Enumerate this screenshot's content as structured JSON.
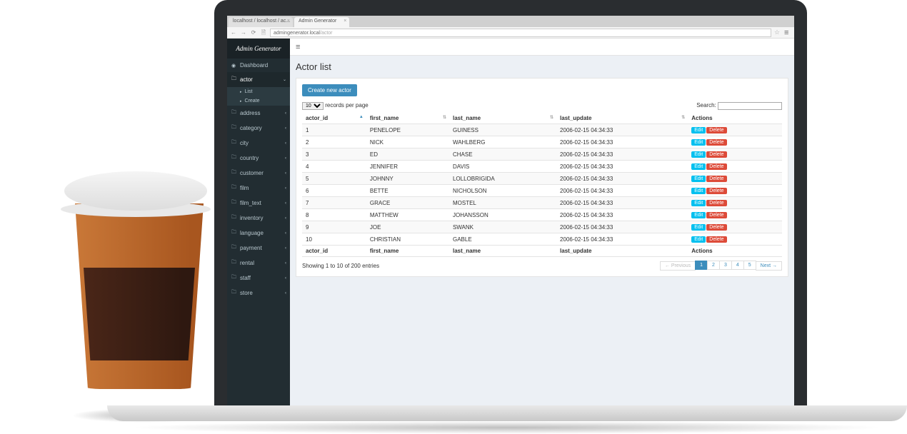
{
  "browser": {
    "tabs": [
      {
        "label": "localhost / localhost / ac..."
      },
      {
        "label": "Admin Generator"
      }
    ],
    "url_host": "admingenerator.local",
    "url_path": "/actor"
  },
  "brand": "Admin Generator",
  "sidebar": {
    "dashboard": "Dashboard",
    "items": [
      {
        "label": "actor",
        "expanded": true,
        "sub": [
          "List",
          "Create"
        ]
      },
      {
        "label": "address"
      },
      {
        "label": "category"
      },
      {
        "label": "city"
      },
      {
        "label": "country"
      },
      {
        "label": "customer"
      },
      {
        "label": "film"
      },
      {
        "label": "film_text"
      },
      {
        "label": "inventory"
      },
      {
        "label": "language"
      },
      {
        "label": "payment"
      },
      {
        "label": "rental"
      },
      {
        "label": "staff"
      },
      {
        "label": "store"
      }
    ]
  },
  "page": {
    "title": "Actor list",
    "create_btn": "Create new actor",
    "records_per_page_prefix": "10",
    "records_per_page_suffix": "records per page",
    "search_label": "Search:",
    "columns": [
      "actor_id",
      "first_name",
      "last_name",
      "last_update",
      "Actions"
    ],
    "rows": [
      {
        "id": "1",
        "first": "PENELOPE",
        "last": "GUINESS",
        "updated": "2006-02-15 04:34:33"
      },
      {
        "id": "2",
        "first": "NICK",
        "last": "WAHLBERG",
        "updated": "2006-02-15 04:34:33"
      },
      {
        "id": "3",
        "first": "ED",
        "last": "CHASE",
        "updated": "2006-02-15 04:34:33"
      },
      {
        "id": "4",
        "first": "JENNIFER",
        "last": "DAVIS",
        "updated": "2006-02-15 04:34:33"
      },
      {
        "id": "5",
        "first": "JOHNNY",
        "last": "LOLLOBRIGIDA",
        "updated": "2006-02-15 04:34:33"
      },
      {
        "id": "6",
        "first": "BETTE",
        "last": "NICHOLSON",
        "updated": "2006-02-15 04:34:33"
      },
      {
        "id": "7",
        "first": "GRACE",
        "last": "MOSTEL",
        "updated": "2006-02-15 04:34:33"
      },
      {
        "id": "8",
        "first": "MATTHEW",
        "last": "JOHANSSON",
        "updated": "2006-02-15 04:34:33"
      },
      {
        "id": "9",
        "first": "JOE",
        "last": "SWANK",
        "updated": "2006-02-15 04:34:33"
      },
      {
        "id": "10",
        "first": "CHRISTIAN",
        "last": "GABLE",
        "updated": "2006-02-15 04:34:33"
      }
    ],
    "edit_label": "Edit",
    "delete_label": "Delete",
    "info_text": "Showing 1 to 10 of 200 entries",
    "pagination": {
      "prev": "← Previous",
      "pages": [
        "1",
        "2",
        "3",
        "4",
        "5"
      ],
      "next": "Next →"
    }
  }
}
